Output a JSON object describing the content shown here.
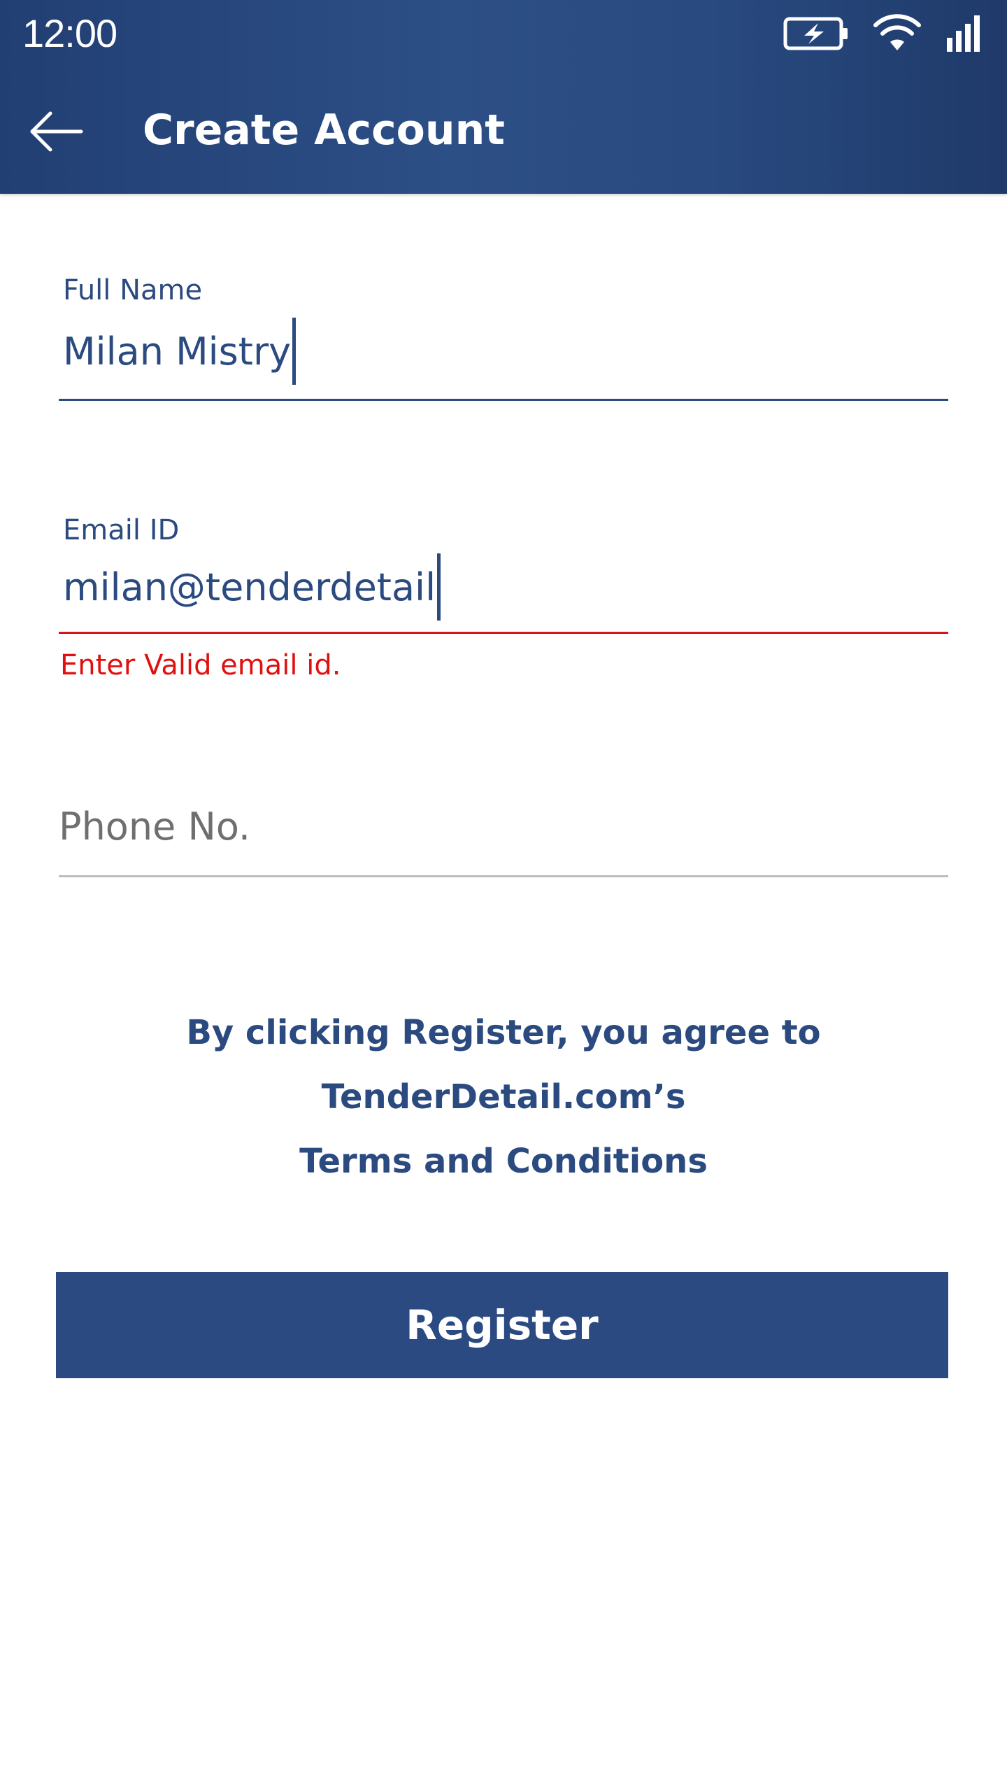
{
  "status_bar": {
    "time": "12:00",
    "icons": [
      "battery-charging-icon",
      "wifi-icon",
      "signal-icon"
    ]
  },
  "app_bar": {
    "back_icon": "arrow-left-icon",
    "title": "Create Account"
  },
  "form": {
    "full_name": {
      "label": "Full Name",
      "value": "Milan Mistry"
    },
    "email": {
      "label": "Email ID",
      "value": "milan@tenderdetail",
      "error": "Enter Valid email id."
    },
    "phone": {
      "placeholder": "Phone No.",
      "value": ""
    }
  },
  "terms": {
    "prefix": "By clicking Register, you agree to TenderDetail.com’s",
    "link": "Terms and Conditions"
  },
  "register_button": {
    "label": "Register"
  },
  "colors": {
    "primary": "#2b4a82",
    "error": "#e01010",
    "placeholder": "#6f6f6f"
  }
}
